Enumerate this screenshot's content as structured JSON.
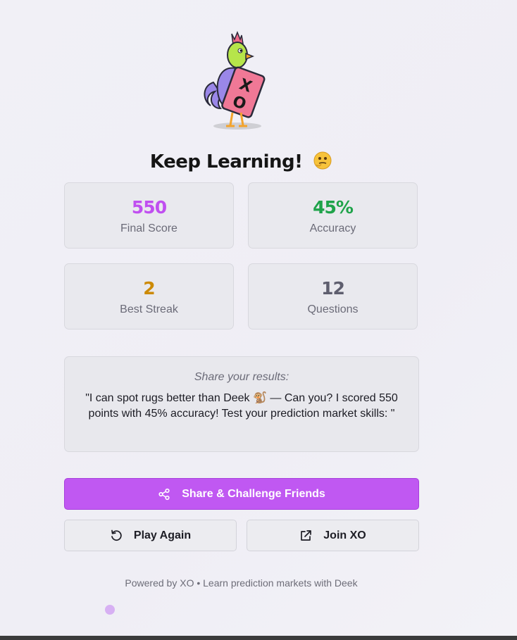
{
  "result": {
    "title": "Keep Learning!",
    "title_emoji": "thinking-face-icon"
  },
  "stats": [
    {
      "value": "550",
      "label": "Final Score",
      "color": "#c04ff0"
    },
    {
      "value": "45%",
      "label": "Accuracy",
      "color": "#1fa34a"
    },
    {
      "value": "2",
      "label": "Best Streak",
      "color": "#cc8a06"
    },
    {
      "value": "12",
      "label": "Questions",
      "color": "#5e5e6e"
    }
  ],
  "share": {
    "heading": "Share your results:",
    "message": "\"I can spot rugs better than Deek 🐒 — Can you? I scored 550 points with 45% accuracy! Test your prediction market skills: \""
  },
  "buttons": {
    "share_label": "Share & Challenge Friends",
    "play_again_label": "Play Again",
    "join_label": "Join XO"
  },
  "footer": {
    "text": "Powered by XO • Learn prediction markets with Deek"
  },
  "colors": {
    "accent": "#c058f2",
    "score": "#c04ff0",
    "accuracy": "#1fa34a",
    "streak": "#cc8a06",
    "questions": "#5e5e6e"
  }
}
